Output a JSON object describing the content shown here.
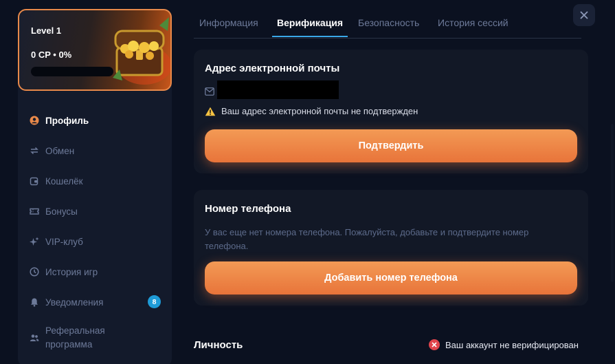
{
  "level_card": {
    "title": "Level 1",
    "points": "0 CP • 0%",
    "progress": 0,
    "image": "treasure-chest"
  },
  "sidebar": {
    "items": [
      {
        "label": "Профиль",
        "icon": "user-icon",
        "active": true
      },
      {
        "label": "Обмен",
        "icon": "exchange-icon",
        "active": false
      },
      {
        "label": "Кошелёк",
        "icon": "wallet-icon",
        "active": false
      },
      {
        "label": "Бонусы",
        "icon": "ticket-icon",
        "active": false
      },
      {
        "label": "VIP-клуб",
        "icon": "sparkle-icon",
        "active": false
      },
      {
        "label": "История игр",
        "icon": "clock-icon",
        "active": false
      },
      {
        "label": "Уведомления",
        "icon": "bell-icon",
        "active": false,
        "badge": "8"
      },
      {
        "label": "Реферальная программа",
        "icon": "users-icon",
        "active": false
      }
    ]
  },
  "tabs": [
    {
      "label": "Информация",
      "active": false
    },
    {
      "label": "Верификация",
      "active": true
    },
    {
      "label": "Безопасность",
      "active": false
    },
    {
      "label": "История сессий",
      "active": false
    }
  ],
  "email_section": {
    "title": "Адрес электронной почты",
    "email_value": "",
    "warning": "Ваш адрес электронной почты не подтвержден",
    "confirm_button": "Подтвердить"
  },
  "phone_section": {
    "title": "Номер телефона",
    "description": "У вас еще нет номера телефона. Пожалуйста, добавьте и подтвердите номер телефона.",
    "add_button": "Добавить номер телефона"
  },
  "identity_section": {
    "title": "Личность",
    "status": "Ваш аккаунт не верифицирован"
  },
  "colors": {
    "accent": "#e8894a",
    "button": "#f08a4b",
    "tab_active": "#3aa8e8",
    "badge": "#1e9bd7",
    "error": "#e0444c",
    "warning": "#f5c242"
  }
}
